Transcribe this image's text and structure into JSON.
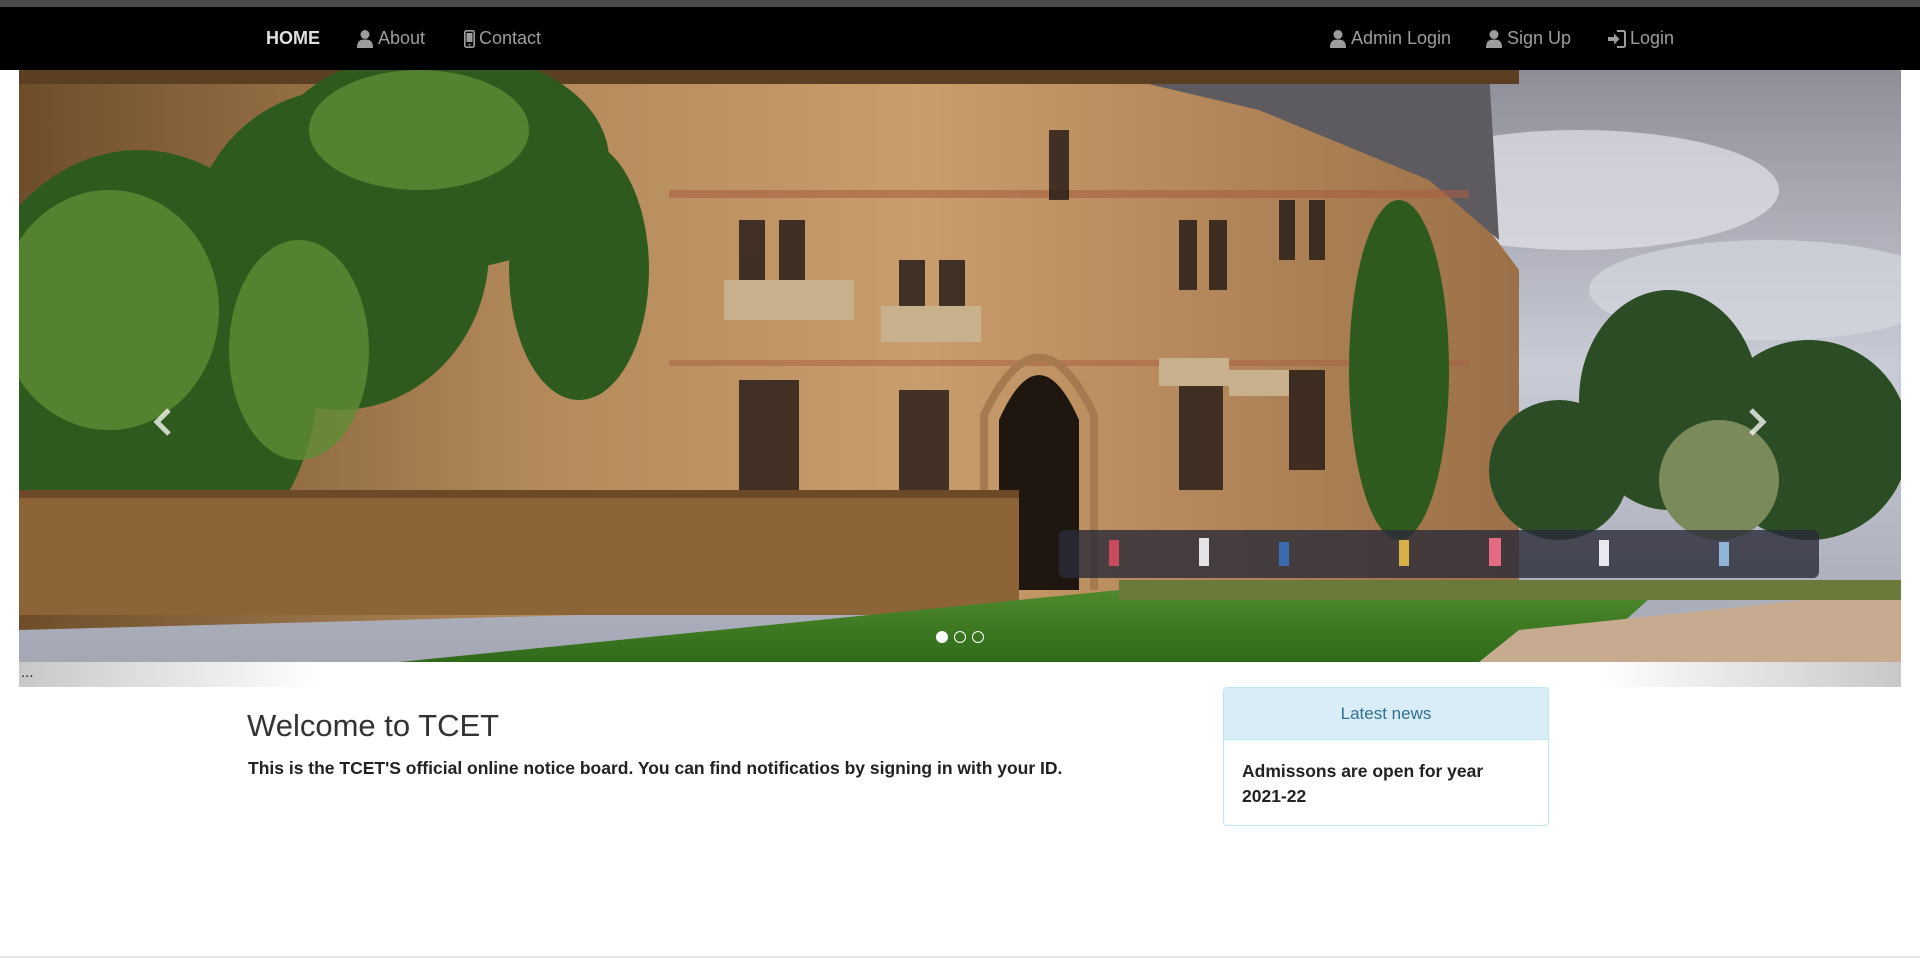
{
  "navbar": {
    "left_items": [
      {
        "label": "HOME",
        "icon": ""
      },
      {
        "label": "About",
        "icon": "user-icon"
      },
      {
        "label": "Contact",
        "icon": "phone-icon"
      }
    ],
    "right_items": [
      {
        "label": "Admin Login",
        "icon": "user-icon"
      },
      {
        "label": "Sign Up",
        "icon": "user-icon"
      },
      {
        "label": "Login",
        "icon": "login-icon"
      }
    ]
  },
  "carousel": {
    "slide_description": "",
    "prev_icon": "chevron-left-icon",
    "next_icon": "chevron-right-icon",
    "indicators": {
      "count": 3,
      "active": 0
    },
    "caption": "..."
  },
  "main": {
    "title": "Welcome to TCET",
    "text": "This is the TCET'S official online notice board. You can find notificatios by signing in with your ID."
  },
  "news": {
    "heading": "Latest news",
    "items": [
      "Admissons are open for year 2021-22"
    ]
  },
  "colors": {
    "navbar_bg": "#000000",
    "nav_text": "#9d9d9d",
    "panel_heading_bg": "#d9edf7",
    "panel_heading_text": "#31708f",
    "panel_border": "#bce8f1"
  }
}
